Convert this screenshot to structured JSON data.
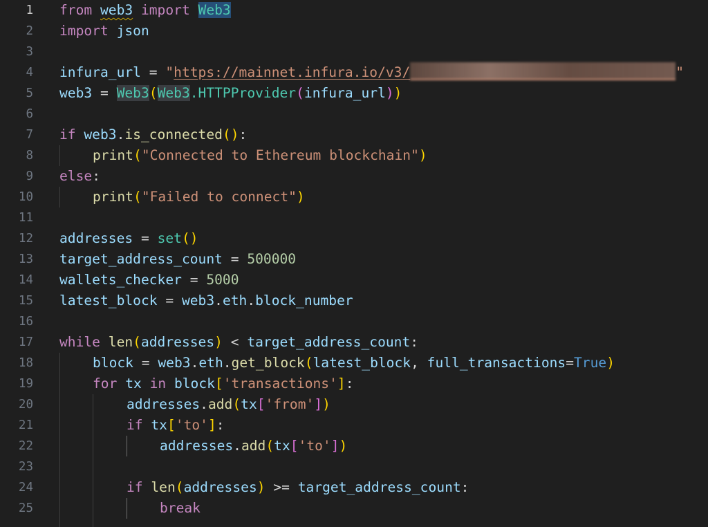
{
  "editor": {
    "language": "python",
    "active_line": 1,
    "lines": [
      {
        "num": "1"
      },
      {
        "num": "2"
      },
      {
        "num": "3"
      },
      {
        "num": "4"
      },
      {
        "num": "5"
      },
      {
        "num": "6"
      },
      {
        "num": "7"
      },
      {
        "num": "8"
      },
      {
        "num": "9"
      },
      {
        "num": "10"
      },
      {
        "num": "11"
      },
      {
        "num": "12"
      },
      {
        "num": "13"
      },
      {
        "num": "14"
      },
      {
        "num": "15"
      },
      {
        "num": "16"
      },
      {
        "num": "17"
      },
      {
        "num": "18"
      },
      {
        "num": "19"
      },
      {
        "num": "20"
      },
      {
        "num": "21"
      },
      {
        "num": "22"
      },
      {
        "num": "23"
      },
      {
        "num": "24"
      },
      {
        "num": "25"
      }
    ]
  },
  "tokens": {
    "l1": [
      "from",
      " ",
      "web3",
      " ",
      "import",
      " ",
      "Web3"
    ],
    "l2": [
      "import",
      " ",
      "json"
    ],
    "l4": [
      "infura_url",
      " = ",
      "\"",
      "https://mainnet.infura.io/v3/",
      "\""
    ],
    "l5": [
      "web3",
      " = ",
      "Web3",
      "(",
      "Web3",
      ".HTTPProvider",
      "(",
      "infura_url",
      ")",
      ")"
    ],
    "l7": [
      "if",
      " ",
      "web3",
      ".",
      "is_connected",
      "(",
      ")",
      ":"
    ],
    "l8": [
      "print",
      "(",
      "\"Connected to Ethereum blockchain\"",
      ")"
    ],
    "l9": [
      "else",
      ":"
    ],
    "l10": [
      "print",
      "(",
      "\"Failed to connect\"",
      ")"
    ],
    "l12": [
      "addresses",
      " = ",
      "set",
      "(",
      ")"
    ],
    "l13": [
      "target_address_count",
      " = ",
      "500000"
    ],
    "l14": [
      "wallets_checker",
      " = ",
      "5000"
    ],
    "l15": [
      "latest_block",
      " = ",
      "web3",
      ".",
      "eth",
      ".",
      "block_number"
    ],
    "l17": [
      "while",
      " ",
      "len",
      "(",
      "addresses",
      ")",
      " < ",
      "target_address_count",
      ":"
    ],
    "l18": [
      "block",
      " = ",
      "web3",
      ".",
      "eth",
      ".",
      "get_block",
      "(",
      "latest_block",
      ", ",
      "full_transactions",
      "=",
      "True",
      ")"
    ],
    "l19": [
      "for",
      " ",
      "tx",
      " ",
      "in",
      " ",
      "block",
      "[",
      "'transactions'",
      "]",
      ":"
    ],
    "l20": [
      "addresses",
      ".",
      "add",
      "(",
      "tx",
      "[",
      "'from'",
      "]",
      ")"
    ],
    "l21": [
      "if",
      " ",
      "tx",
      "[",
      "'to'",
      "]",
      ":"
    ],
    "l22": [
      "addresses",
      ".",
      "add",
      "(",
      "tx",
      "[",
      "'to'",
      "]",
      ")"
    ],
    "l24": [
      "if",
      " ",
      "len",
      "(",
      "addresses",
      ")",
      " >= ",
      "target_address_count",
      ":"
    ],
    "l25": [
      "break"
    ]
  },
  "colors": {
    "background": "#1f1f1f",
    "keyword_control": "#c586c0",
    "keyword": "#569cd6",
    "variable": "#9cdcfe",
    "function": "#dcdcaa",
    "class": "#4ec9b0",
    "string": "#ce9178",
    "number": "#b5cea8",
    "bracket_level1": "#ffd700",
    "bracket_level2": "#da70d6",
    "bracket_level3": "#179fff"
  }
}
